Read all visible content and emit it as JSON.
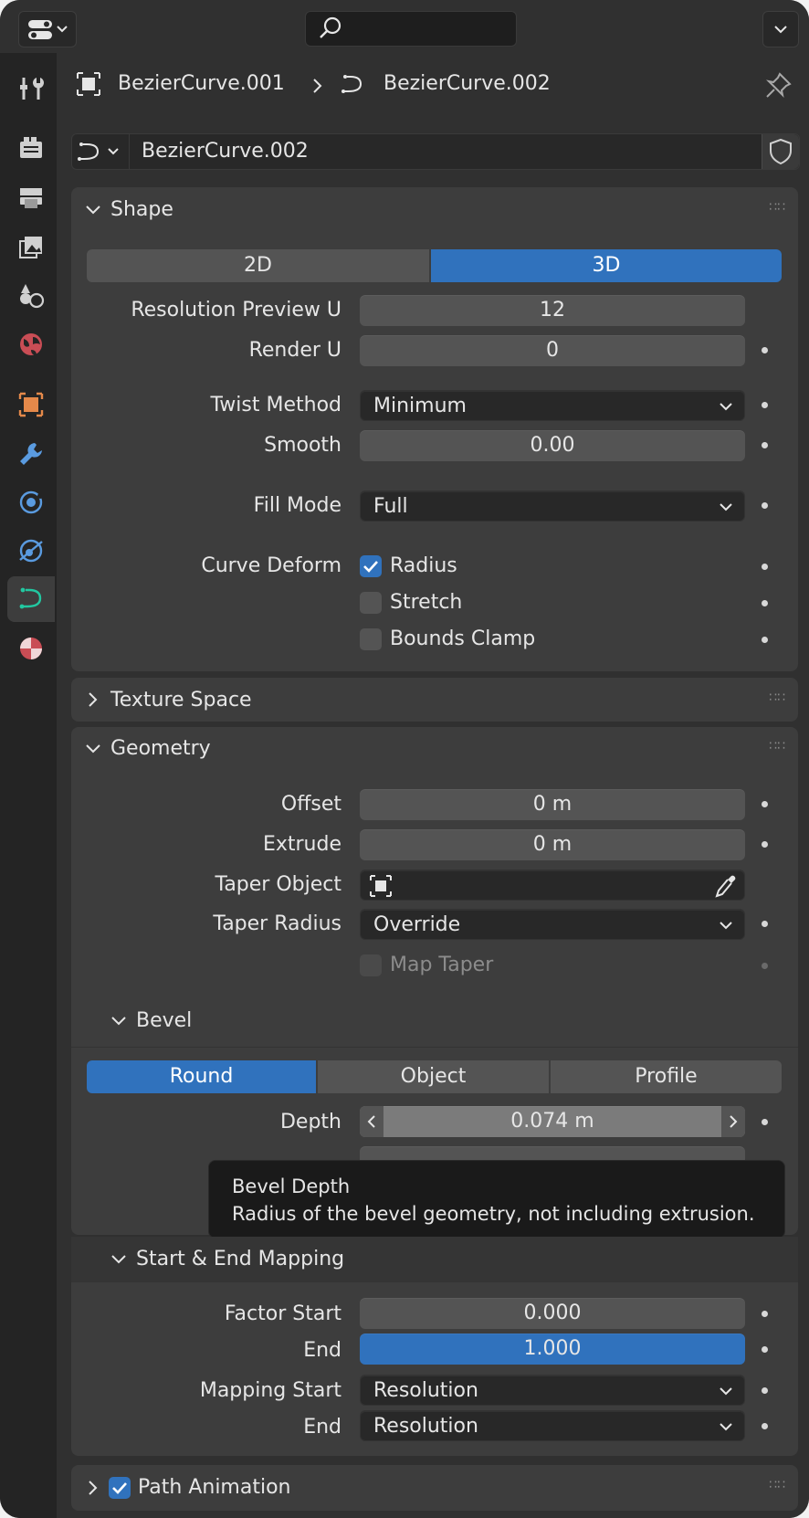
{
  "header": {
    "search_placeholder": ""
  },
  "sidebar": {
    "tabs": [
      {
        "name": "tool-tab",
        "icon": "tool-icon"
      },
      {
        "name": "render-tab",
        "icon": "render-icon"
      },
      {
        "name": "output-tab",
        "icon": "output-icon"
      },
      {
        "name": "view-layer-tab",
        "icon": "view-layer-icon"
      },
      {
        "name": "scene-tab",
        "icon": "scene-icon"
      },
      {
        "name": "world-tab",
        "icon": "world-icon"
      },
      {
        "name": "object-tab",
        "icon": "object-icon"
      },
      {
        "name": "modifiers-tab",
        "icon": "wrench-icon"
      },
      {
        "name": "particles-tab",
        "icon": "particles-icon"
      },
      {
        "name": "physics-tab",
        "icon": "physics-icon"
      },
      {
        "name": "curve-data-tab",
        "icon": "curve-data-icon",
        "active": true
      },
      {
        "name": "material-tab",
        "icon": "material-icon"
      }
    ]
  },
  "breadcrumb": {
    "object": "BezierCurve.001",
    "data": "BezierCurve.002"
  },
  "datablock": {
    "name": "BezierCurve.002"
  },
  "shape": {
    "title": "Shape",
    "dim_2d": "2D",
    "dim_3d": "3D",
    "dimension_selected": "3D",
    "resolution_preview_label": "Resolution Preview U",
    "resolution_preview_value": "12",
    "render_u_label": "Render U",
    "render_u_value": "0",
    "twist_method_label": "Twist Method",
    "twist_method_value": "Minimum",
    "smooth_label": "Smooth",
    "smooth_value": "0.00",
    "fill_mode_label": "Fill Mode",
    "fill_mode_value": "Full",
    "curve_deform_label": "Curve Deform",
    "radius_label": "Radius",
    "radius_checked": true,
    "stretch_label": "Stretch",
    "stretch_checked": false,
    "bounds_clamp_label": "Bounds Clamp",
    "bounds_clamp_checked": false
  },
  "texture_space": {
    "title": "Texture Space"
  },
  "geometry": {
    "title": "Geometry",
    "offset_label": "Offset",
    "offset_value": "0 m",
    "extrude_label": "Extrude",
    "extrude_value": "0 m",
    "taper_object_label": "Taper Object",
    "taper_object_value": "",
    "taper_radius_label": "Taper Radius",
    "taper_radius_value": "Override",
    "map_taper_label": "Map Taper",
    "map_taper_checked": false
  },
  "bevel": {
    "title": "Bevel",
    "mode_round": "Round",
    "mode_object": "Object",
    "mode_profile": "Profile",
    "mode_selected": "Round",
    "depth_label": "Depth",
    "depth_value": "0.074 m"
  },
  "tooltip": {
    "title": "Bevel Depth",
    "description": "Radius of the bevel geometry, not including extrusion."
  },
  "mapping": {
    "title": "Start & End Mapping",
    "factor_start_label": "Factor Start",
    "factor_start_value": "0.000",
    "factor_end_label": "End",
    "factor_end_value": "1.000",
    "mapping_start_label": "Mapping Start",
    "mapping_start_value": "Resolution",
    "mapping_end_label": "End",
    "mapping_end_value": "Resolution"
  },
  "path_animation": {
    "title": "Path Animation",
    "enabled": true
  },
  "colors": {
    "accent": "#3072bd",
    "panel": "#3d3d3d",
    "field": "#545454",
    "dark_field": "#282828",
    "active_tab_icon": "#22c7a0"
  }
}
